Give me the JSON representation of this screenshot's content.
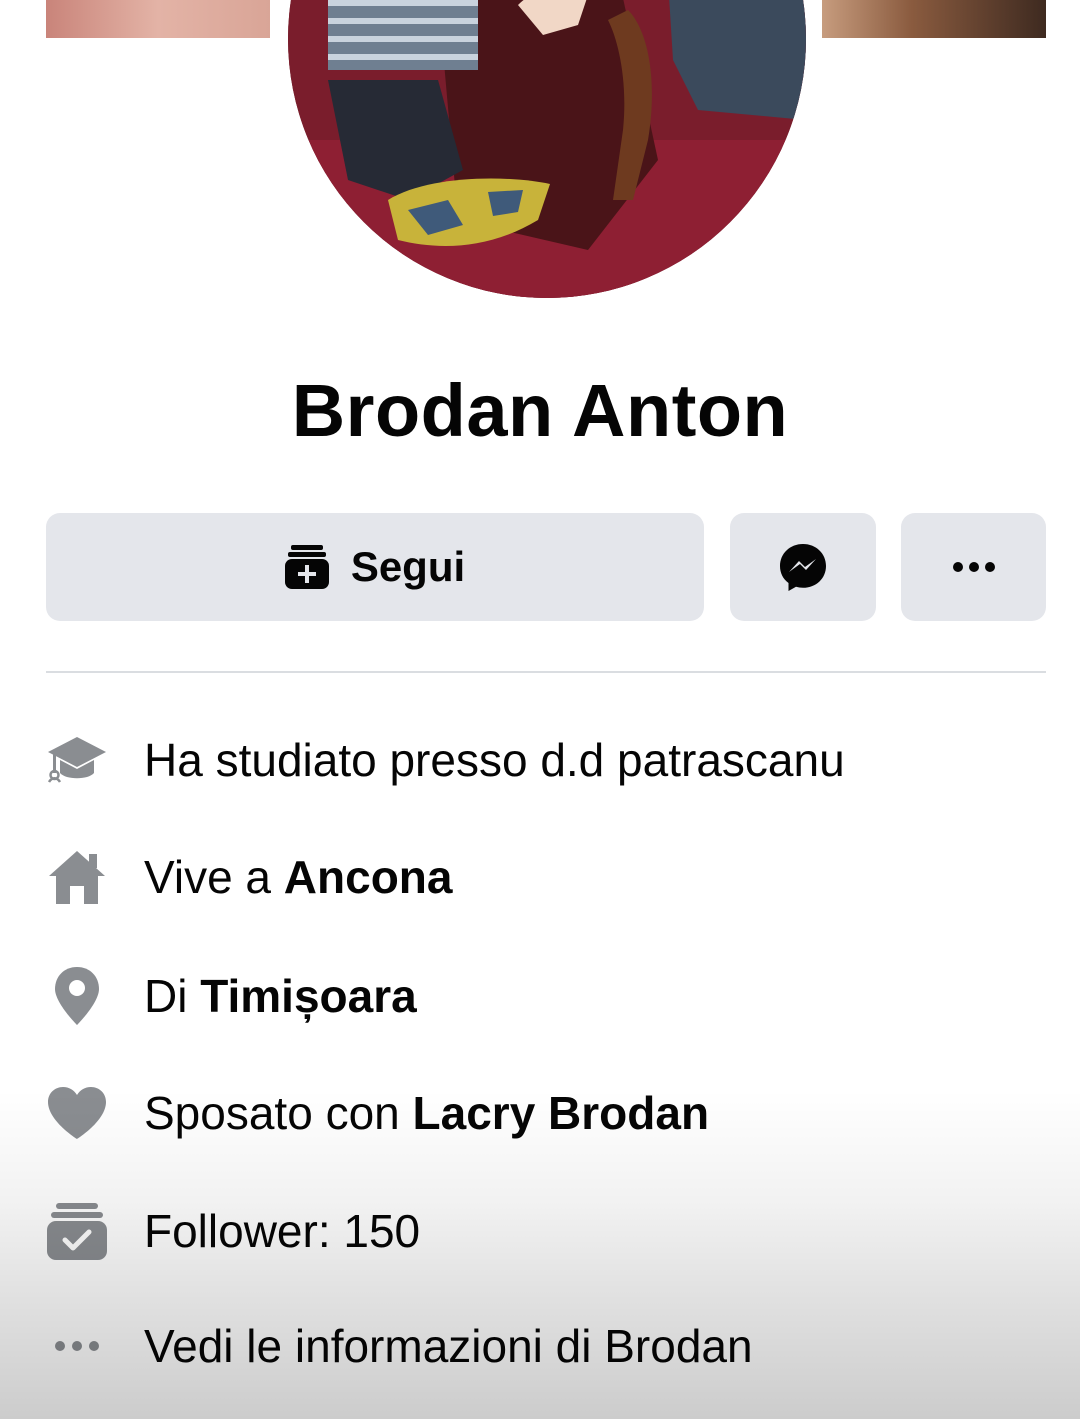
{
  "profile": {
    "name": "Brodan Anton"
  },
  "actions": {
    "follow_label": "Segui",
    "follow_icon": "follow-plus-icon",
    "messenger_icon": "messenger-icon",
    "more_icon": "more-dots-icon"
  },
  "intro": {
    "education": {
      "icon": "graduation-cap-icon",
      "text": "Ha studiato presso d.d patrascanu"
    },
    "lives": {
      "icon": "home-icon",
      "prefix": "Vive a ",
      "value": "Ancona"
    },
    "from": {
      "icon": "location-pin-icon",
      "prefix": "Di ",
      "value": "Timișoara"
    },
    "relationship": {
      "icon": "heart-icon",
      "prefix": "Sposato con ",
      "value": "Lacry Brodan"
    },
    "followers": {
      "icon": "followers-check-icon",
      "text": "Follower: 150"
    },
    "see_more": {
      "icon": "more-dots-icon",
      "text": "Vedi le informazioni di Brodan"
    }
  },
  "colors": {
    "button_bg": "#e4e6eb",
    "icon_gray": "#8a8d91",
    "text": "#050505",
    "divider": "#dadde1"
  }
}
